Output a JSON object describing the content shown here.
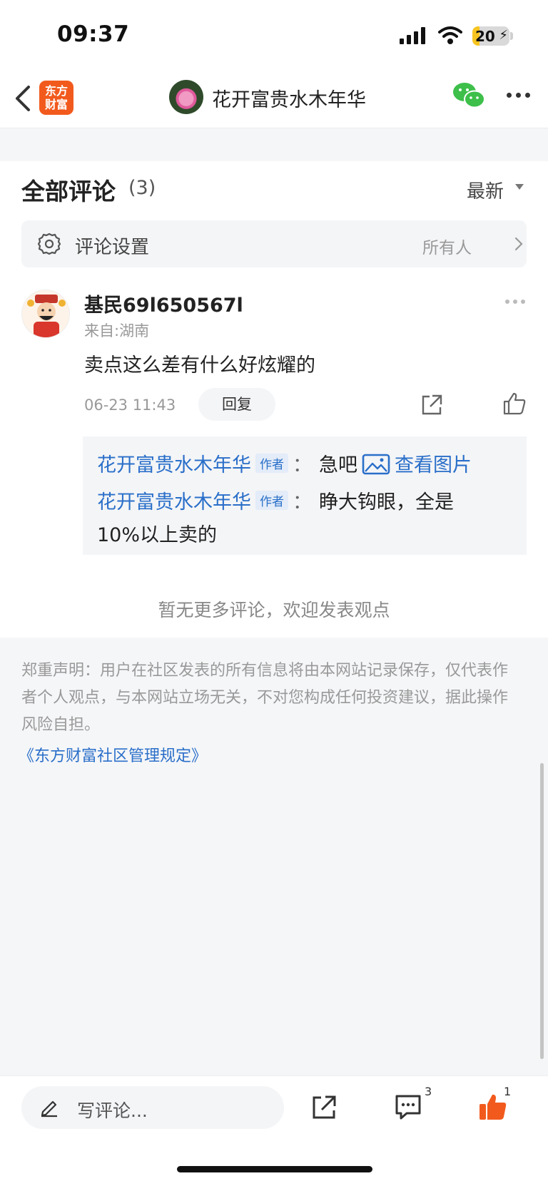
{
  "status_bar": {
    "time": "09:37",
    "battery": "20",
    "battery_level": 0.2,
    "charging": true
  },
  "header": {
    "app_logo_text": "东方\n财富",
    "title": "花开富贵水木年华"
  },
  "comments_section": {
    "title": "全部评论",
    "count": "(3)",
    "sort_label": "最新",
    "settings": {
      "label": "评论设置",
      "value": "所有人"
    },
    "comments": [
      {
        "user": "基民69l650567l",
        "location": "来自:湖南",
        "text": "卖点这么差有什么好炫耀的",
        "date": "06-23 11:43",
        "reply_label": "回复",
        "replies": [
          {
            "author": "花开富贵水木年华",
            "tag": "作者",
            "colon": "：",
            "text": "急吧",
            "image_link": "查看图片"
          },
          {
            "author": "花开富贵水木年华",
            "tag": "作者",
            "colon": "：",
            "text": "睁大钩眼，全是",
            "continuation": "10%以上卖的"
          }
        ]
      }
    ],
    "no_more": "暂无更多评论，欢迎发表观点"
  },
  "disclaimer": {
    "text": "郑重声明：用户在社区发表的所有信息将由本网站记录保存，仅代表作者个人观点，与本网站立场无关，不对您构成任何投资建议，据此操作风险自担。",
    "rules_link": "《东方财富社区管理规定》"
  },
  "bottom_bar": {
    "comment_placeholder": "写评论...",
    "comment_count": "3",
    "like_count": "1"
  },
  "colors": {
    "accent_blue": "#2a6fc9",
    "like_orange": "#f25a1d",
    "wechat_green": "#3dbf4a",
    "logo_orange": "#f25a1d"
  }
}
